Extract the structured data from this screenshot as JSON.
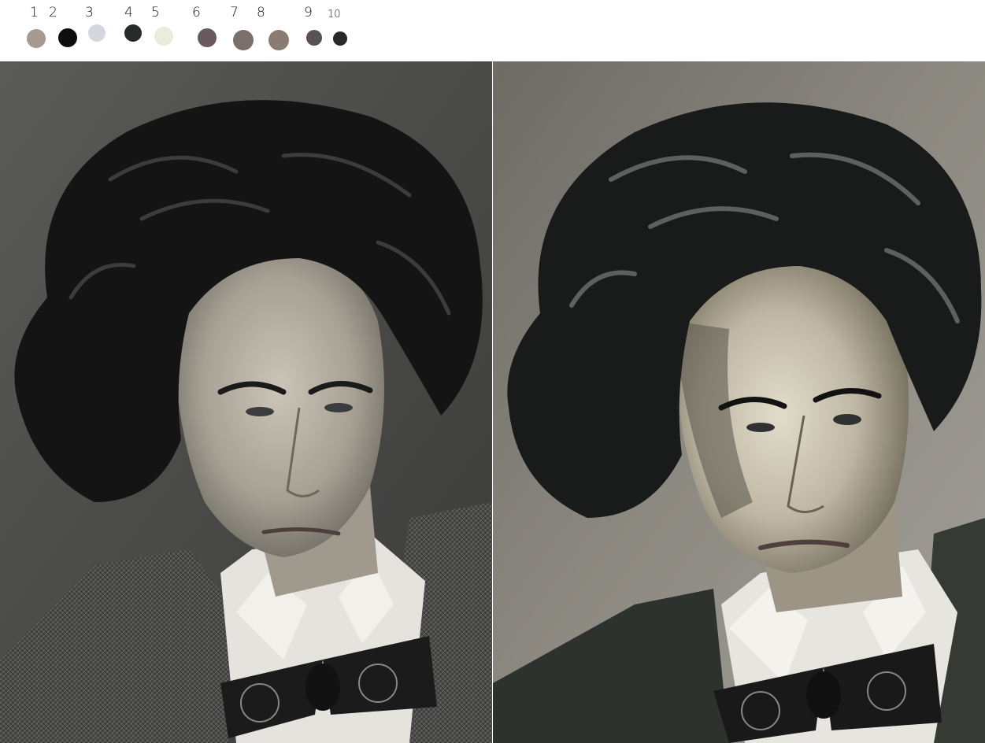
{
  "palette": {
    "labels": [
      "1",
      "2",
      "3",
      "4",
      "5",
      "6",
      "7",
      "8",
      "9",
      "10"
    ],
    "swatch_colors": [
      "#a69a92",
      "#0e0d0d",
      "#d3d7de",
      "#262a29",
      "#ebeddc",
      "#6a5a5d",
      "#7a6f6a",
      "#8a7b74",
      "#5a524e",
      "#2a2928"
    ]
  },
  "panels": {
    "reference": {
      "subject": "photo-reference-portrait"
    },
    "painting": {
      "subject": "digital-painting-study"
    }
  }
}
